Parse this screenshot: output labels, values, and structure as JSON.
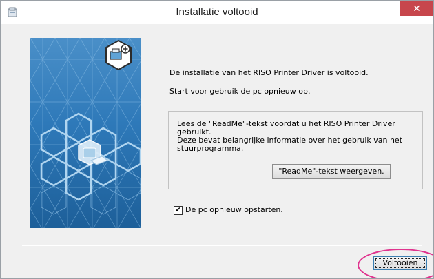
{
  "window": {
    "title": "Installatie voltooid",
    "close_glyph": "✕"
  },
  "content": {
    "line1": "De installatie van het RISO Printer Driver is voltooid.",
    "line2": "Start voor gebruik de pc opnieuw op."
  },
  "readme_group": {
    "text": "Lees de \"ReadMe\"-tekst voordat u het RISO Printer Driver gebruikt.\nDeze bevat belangrijke informatie over het gebruik van het stuurprogramma.",
    "button_label": "\"ReadMe\"-tekst weergeven."
  },
  "restart_checkbox": {
    "label": "De pc opnieuw opstarten.",
    "checked": true,
    "check_glyph": "✔"
  },
  "footer": {
    "finish_label": "Voltooien"
  },
  "colors": {
    "close_button": "#c7464c",
    "highlight": "#e0338e",
    "banner_blue": "#2f7fc1"
  },
  "icons": [
    "installer-app-icon",
    "close-icon",
    "hexagon-banner",
    "printer-plus-icon",
    "check-icon"
  ]
}
